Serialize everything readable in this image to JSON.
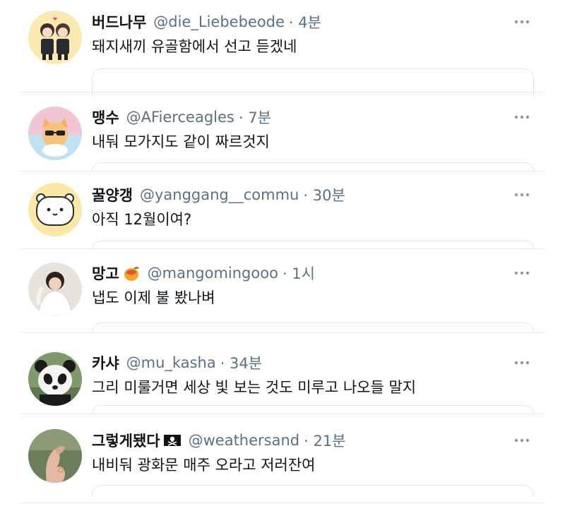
{
  "tweets": [
    {
      "name": "버드나무",
      "handle": "@die_Liebebeode",
      "time": "· 4분",
      "text": "돼지새끼 유골함에서 선고 듣겠네",
      "avatar": "couple-illustration-avatar"
    },
    {
      "name": "맹수",
      "handle": "@AFierceagles",
      "time": "· 7분",
      "text": "내둬 모가지도 같이 짜르것지",
      "avatar": "cat-sunglasses-avatar"
    },
    {
      "name": "꿀양갱",
      "handle": "@yanggang__commu",
      "time": "· 30분",
      "text": "아직 12월이여?",
      "avatar": "hamster-cartoon-avatar"
    },
    {
      "name": "망고",
      "emoji": "mango",
      "handle": "@mangomingooo",
      "time": "· 1시",
      "text": "냅도 이제 불 봤나벼",
      "avatar": "bride-photo-avatar"
    },
    {
      "name": "카샤",
      "handle": "@mu_kasha",
      "time": "· 34분",
      "text": "그리 미룰거면 세상 빛 보는 것도 미루고 나오들 말지",
      "avatar": "panda-avatar"
    },
    {
      "name": "그렇게됐다",
      "emoji": "pirate-flag",
      "handle": "@weathersand",
      "time": "· 21분",
      "text": "내비둬 광화문 매주 오라고 저러잔여",
      "avatar": "hand-gesture-avatar"
    }
  ],
  "more_icon": "more-options-icon"
}
